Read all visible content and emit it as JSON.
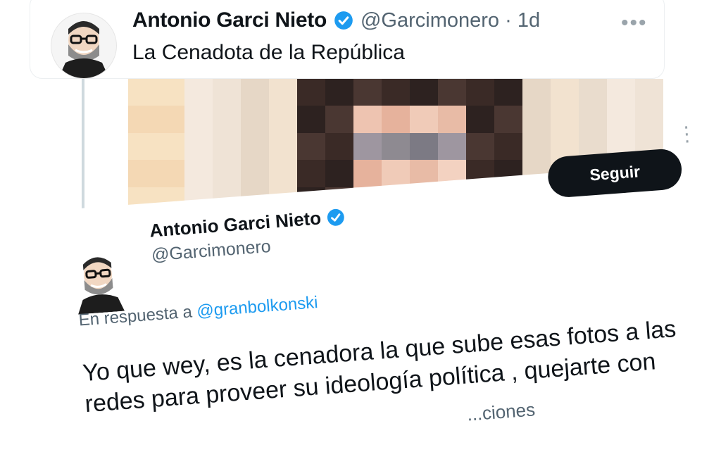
{
  "main_tweet": {
    "author_name": "Antonio Garci Nieto",
    "handle": "@Garcimonero",
    "separator": "·",
    "timestamp": "1d",
    "text": "La Cenadota de la República",
    "more_icon": "more-horizontal-icon",
    "verified_icon": "verified-badge-icon"
  },
  "media": {
    "pixelated": true
  },
  "embedded_tweet": {
    "follow_label": "Seguir",
    "author_name": "Antonio Garci Nieto",
    "handle": "@Garcimonero",
    "reply_prefix": "En respuesta a",
    "reply_to": "@granbolkonski",
    "text": "Yo que wey, es la cenadora la que sube esas fotos a las redes para proveer su ideología política , quejarte con",
    "partial_text": "...ciones"
  },
  "colors": {
    "verified": "#1d9bf0",
    "link": "#1d9bf0",
    "secondary_text": "#536471",
    "follow_button_bg": "#0f1419"
  }
}
